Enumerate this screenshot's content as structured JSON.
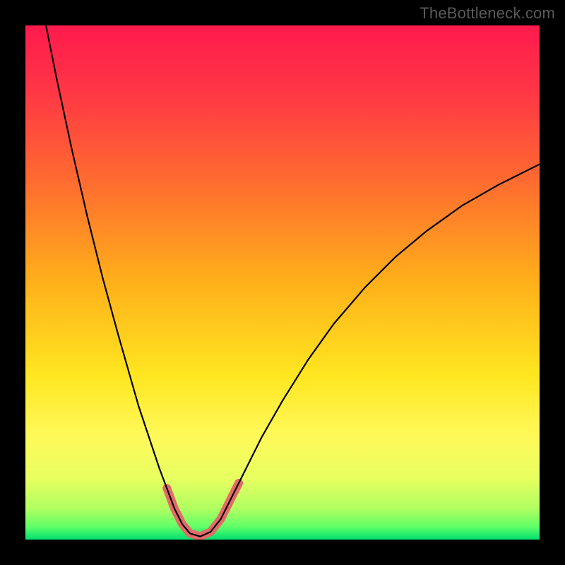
{
  "watermark": "TheBottleneck.com",
  "chart_data": {
    "type": "line",
    "title": "",
    "xlabel": "",
    "ylabel": "",
    "xlim": [
      0,
      100
    ],
    "ylim": [
      0,
      100
    ],
    "gradient_stops": [
      {
        "offset": 0,
        "color": "#ff1a4d"
      },
      {
        "offset": 0.12,
        "color": "#ff3446"
      },
      {
        "offset": 0.3,
        "color": "#ff6a30"
      },
      {
        "offset": 0.5,
        "color": "#ffb01a"
      },
      {
        "offset": 0.68,
        "color": "#ffe620"
      },
      {
        "offset": 0.8,
        "color": "#fff95a"
      },
      {
        "offset": 0.88,
        "color": "#e8ff60"
      },
      {
        "offset": 0.94,
        "color": "#b0ff60"
      },
      {
        "offset": 0.975,
        "color": "#60ff68"
      },
      {
        "offset": 1.0,
        "color": "#00e070"
      }
    ],
    "series": [
      {
        "name": "curve",
        "stroke": "#000000",
        "stroke_width": 2.2,
        "points": [
          {
            "x": 4,
            "y": 100
          },
          {
            "x": 6,
            "y": 90
          },
          {
            "x": 9,
            "y": 76
          },
          {
            "x": 12,
            "y": 63
          },
          {
            "x": 15,
            "y": 51
          },
          {
            "x": 18,
            "y": 40
          },
          {
            "x": 20,
            "y": 33
          },
          {
            "x": 22,
            "y": 26
          },
          {
            "x": 24,
            "y": 20
          },
          {
            "x": 26,
            "y": 14
          },
          {
            "x": 27.5,
            "y": 10
          },
          {
            "x": 29,
            "y": 6
          },
          {
            "x": 30.5,
            "y": 3
          },
          {
            "x": 32,
            "y": 1.2
          },
          {
            "x": 34,
            "y": 0.6
          },
          {
            "x": 36,
            "y": 1.5
          },
          {
            "x": 38,
            "y": 4
          },
          {
            "x": 40,
            "y": 8
          },
          {
            "x": 43,
            "y": 14
          },
          {
            "x": 46,
            "y": 20
          },
          {
            "x": 50,
            "y": 27
          },
          {
            "x": 55,
            "y": 35
          },
          {
            "x": 60,
            "y": 42
          },
          {
            "x": 66,
            "y": 49
          },
          {
            "x": 72,
            "y": 55
          },
          {
            "x": 78,
            "y": 60
          },
          {
            "x": 85,
            "y": 65
          },
          {
            "x": 92,
            "y": 69
          },
          {
            "x": 100,
            "y": 73
          }
        ]
      },
      {
        "name": "highlight",
        "stroke": "#e46a6a",
        "stroke_width": 12,
        "linecap": "round",
        "points": [
          {
            "x": 27.5,
            "y": 10
          },
          {
            "x": 29,
            "y": 6
          },
          {
            "x": 30.5,
            "y": 3
          },
          {
            "x": 32,
            "y": 1.2
          },
          {
            "x": 34,
            "y": 0.6
          },
          {
            "x": 36,
            "y": 1.5
          },
          {
            "x": 38,
            "y": 4
          },
          {
            "x": 40,
            "y": 8
          },
          {
            "x": 41.5,
            "y": 11
          }
        ]
      }
    ]
  }
}
